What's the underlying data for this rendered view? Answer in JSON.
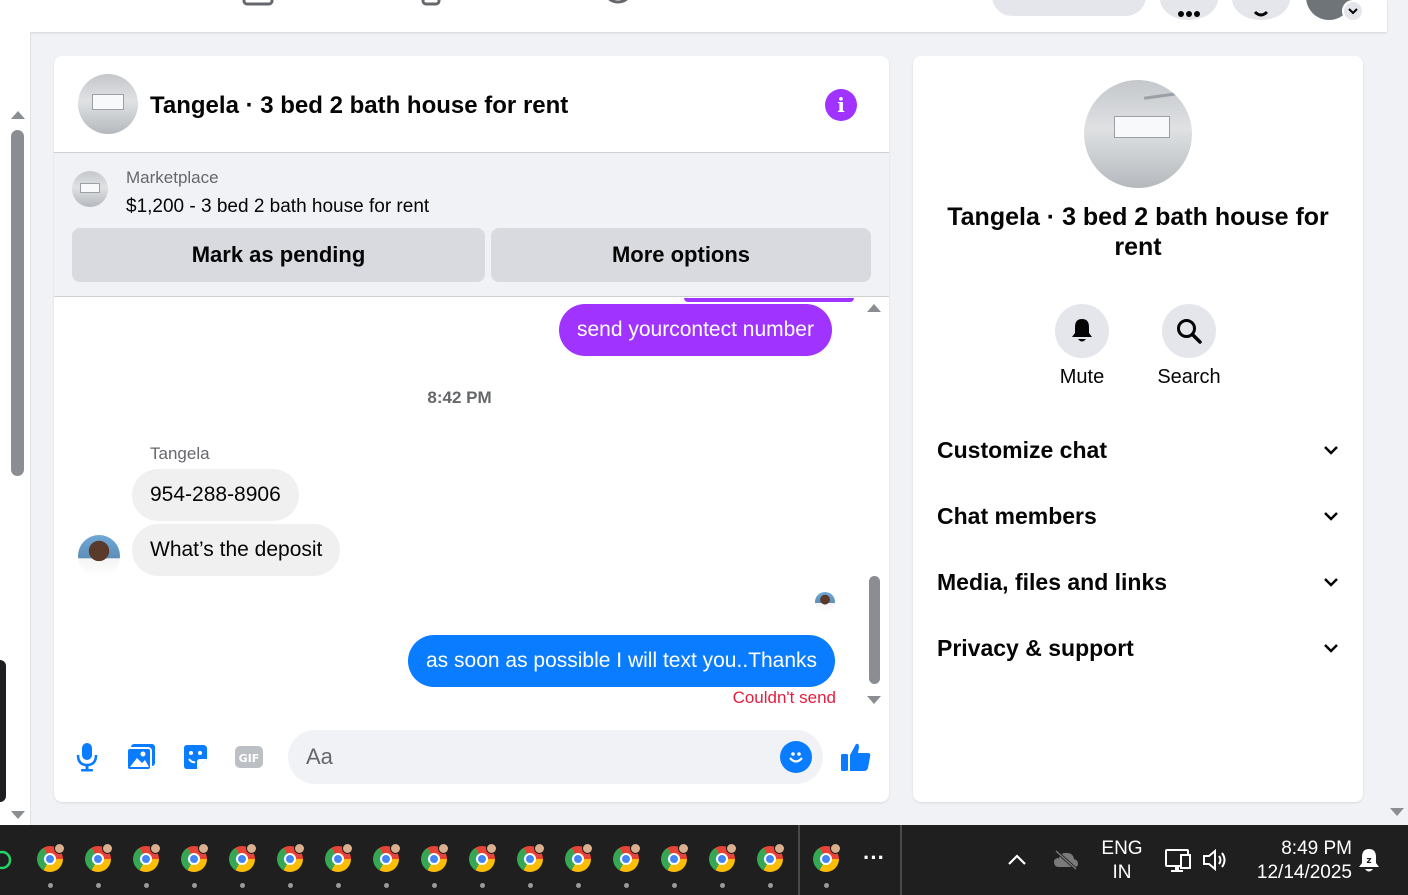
{
  "chat": {
    "title": "Tangela · 3 bed 2 bath house for rent",
    "marketplace_label": "Marketplace",
    "listing": "$1,200 - 3 bed 2 bath house for rent",
    "mark_pending": "Mark as pending",
    "more_options": "More options"
  },
  "messages": {
    "out1": "send yourcontect number",
    "timestamp": "8:42 PM",
    "sender": "Tangela",
    "in1": "954-288-8906",
    "in2": "What’s the deposit",
    "out2": "as soon as possible I will text you..Thanks",
    "error": "Couldn't send"
  },
  "composer": {
    "placeholder": "Aa",
    "gif_label": "GIF"
  },
  "info": {
    "name": "Tangela · 3 bed 2 bath house for rent",
    "mute": "Mute",
    "search": "Search",
    "sections": [
      "Customize chat",
      "Chat members",
      "Media, files and links",
      "Privacy & support"
    ]
  },
  "taskbar": {
    "lang": "ENG",
    "region": "IN",
    "time": "8:49 PM",
    "date": "12/14/2025",
    "more": "···"
  },
  "colors": {
    "purple_bubble": "#a033ff",
    "blue_bubble": "#0a7cff",
    "error": "#e41e3f"
  }
}
